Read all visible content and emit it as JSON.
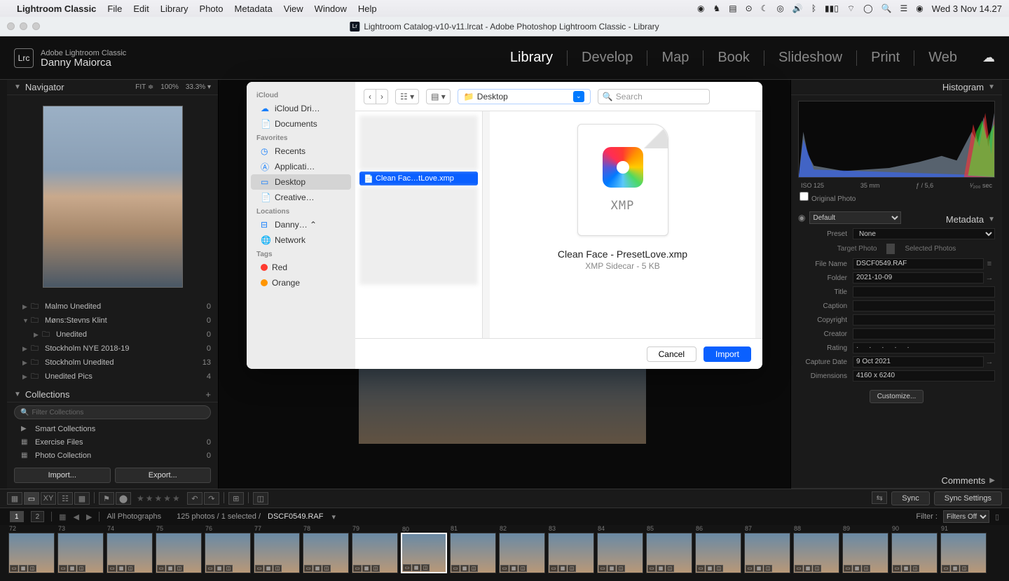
{
  "menubar": {
    "app": "Lightroom Classic",
    "items": [
      "File",
      "Edit",
      "Library",
      "Photo",
      "Metadata",
      "View",
      "Window",
      "Help"
    ],
    "clock": "Wed 3 Nov  14.27"
  },
  "window": {
    "title": "Lightroom Catalog-v10-v11.lrcat - Adobe Photoshop Lightroom Classic - Library"
  },
  "identity": {
    "app_full": "Adobe Lightroom Classic",
    "user": "Danny Maiorca",
    "badge": "Lrc"
  },
  "modules": [
    "Library",
    "Develop",
    "Map",
    "Book",
    "Slideshow",
    "Print",
    "Web"
  ],
  "active_module": "Library",
  "navigator": {
    "title": "Navigator",
    "zoom": [
      "FIT ≑",
      "100%",
      "33.3% ▾"
    ]
  },
  "folders": [
    {
      "name": "Malmo Unedited",
      "count": "0",
      "depth": 0
    },
    {
      "name": "Møns:Stevns Klint",
      "count": "0",
      "depth": 0,
      "expanded": true
    },
    {
      "name": "Unedited",
      "count": "0",
      "depth": 1
    },
    {
      "name": "Stockholm NYE 2018-19",
      "count": "0",
      "depth": 0
    },
    {
      "name": "Stockholm Unedited",
      "count": "13",
      "depth": 0
    },
    {
      "name": "Unedited Pics",
      "count": "4",
      "depth": 0
    }
  ],
  "collections": {
    "title": "Collections",
    "filter_placeholder": "Filter Collections",
    "items": [
      {
        "name": "Smart Collections",
        "count": "",
        "icon": "▶"
      },
      {
        "name": "Exercise Files",
        "count": "0",
        "icon": "▦"
      },
      {
        "name": "Photo Collection",
        "count": "0",
        "icon": "▦"
      }
    ]
  },
  "left_buttons": {
    "import": "Import...",
    "export": "Export..."
  },
  "histogram": {
    "title": "Histogram",
    "iso": "ISO 125",
    "focal": "35 mm",
    "aperture": "ƒ / 5,6",
    "shutter": "¹⁄₂₀₀ sec",
    "orig": "Original Photo"
  },
  "metadata": {
    "title": "Metadata",
    "view": "Default",
    "preset_label": "Preset",
    "preset_value": "None",
    "pills": [
      "Target Photo",
      "Selected Photos"
    ],
    "rows": [
      {
        "label": "File Name",
        "value": "DSCF0549.RAF",
        "icon": "≡"
      },
      {
        "label": "Folder",
        "value": "2021-10-09",
        "icon": "→"
      },
      {
        "label": "Title",
        "value": ""
      },
      {
        "label": "Caption",
        "value": ""
      },
      {
        "label": "Copyright",
        "value": ""
      },
      {
        "label": "Creator",
        "value": ""
      },
      {
        "label": "Rating",
        "value": "·  ·  ·  ·  ·",
        "rating": true
      },
      {
        "label": "Capture Date",
        "value": "9 Oct 2021",
        "icon": "→"
      },
      {
        "label": "Dimensions",
        "value": "4160 x 6240"
      }
    ],
    "customize": "Customize..."
  },
  "comments_title": "Comments",
  "right_sync": {
    "sync": "Sync",
    "settings": "Sync Settings"
  },
  "toolbar_icons": [
    "▦▦",
    "▭",
    "XY",
    "☷",
    "▦",
    "⚑",
    "⬤",
    "★★★★★",
    "↶↷",
    "⊞",
    "◫"
  ],
  "filmstrip_status": {
    "pages": [
      "1",
      "2"
    ],
    "path": "All Photographs",
    "counts": "125 photos / 1 selected /",
    "file": "DSCF0549.RAF",
    "filter_label": "Filter :",
    "filter_value": "Filters Off"
  },
  "film_indices": [
    "72",
    "73",
    "74",
    "75",
    "76",
    "77",
    "78",
    "79",
    "80",
    "81",
    "82",
    "83",
    "84",
    "85",
    "86",
    "87",
    "88",
    "89",
    "90",
    "91"
  ],
  "film_selected": 8,
  "finder": {
    "sidebar": {
      "groups": [
        {
          "label": "iCloud",
          "items": [
            {
              "icon": "☁",
              "name": "iCloud Dri…"
            },
            {
              "icon": "📄",
              "name": "Documents"
            }
          ]
        },
        {
          "label": "Favorites",
          "items": [
            {
              "icon": "◷",
              "name": "Recents"
            },
            {
              "icon": "Ⓐ",
              "name": "Applicati…"
            },
            {
              "icon": "▭",
              "name": "Desktop",
              "sel": true
            },
            {
              "icon": "📄",
              "name": "Creative…"
            }
          ]
        },
        {
          "label": "Locations",
          "items": [
            {
              "icon": "⊟",
              "name": "Danny… ⌃"
            },
            {
              "icon": "🌐",
              "name": "Network"
            }
          ]
        },
        {
          "label": "Tags",
          "items": [
            {
              "dot": "#ff3b30",
              "name": "Red"
            },
            {
              "dot": "#ff9500",
              "name": "Orange"
            }
          ]
        }
      ]
    },
    "toolbar": {
      "location": "Desktop",
      "search_placeholder": "Search"
    },
    "file_selected": "Clean Fac…tLove.xmp",
    "preview": {
      "name": "Clean Face - PresetLove.xmp",
      "meta": "XMP Sidecar - 5 KB",
      "badge": "XMP"
    },
    "footer": {
      "cancel": "Cancel",
      "import": "Import"
    }
  }
}
